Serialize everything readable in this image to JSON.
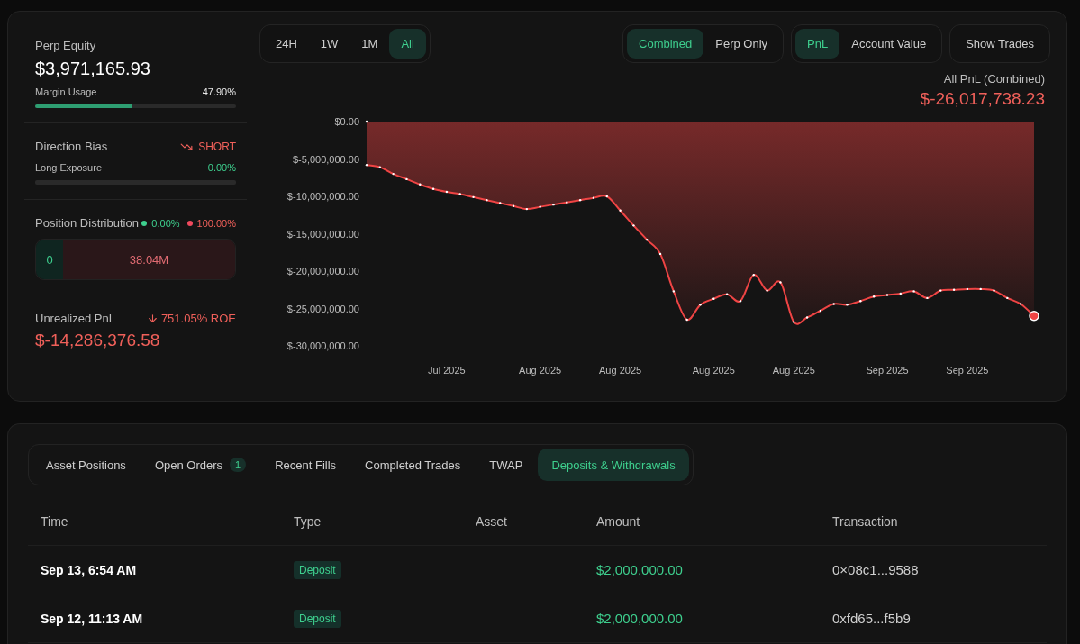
{
  "summary": {
    "equity": {
      "label": "Perp Equity",
      "value": "$3,971,165.93",
      "meter_label": "Margin Usage",
      "meter_reading": "47.90%",
      "level": 0.479
    },
    "bias": {
      "label": "Direction Bias",
      "value": "SHORT",
      "meter_label": "Long Exposure",
      "meter_reading": "0.00%",
      "level": 0
    },
    "distribution": {
      "label": "Position Distribution",
      "long_share": "0.00%",
      "short_share": "100.00%",
      "long_value": "0",
      "short_value": "38.04M"
    },
    "unrealized": {
      "label": "Unrealized PnL",
      "roe": "751.05% ROE",
      "value": "$-14,286,376.58"
    }
  },
  "ranges": [
    {
      "label": "24H",
      "selected": false
    },
    {
      "label": "1W",
      "selected": false
    },
    {
      "label": "1M",
      "selected": false
    },
    {
      "label": "All",
      "selected": true
    }
  ],
  "scopes": [
    {
      "label": "Combined",
      "selected": true
    },
    {
      "label": "Perp Only",
      "selected": false
    }
  ],
  "metrics": [
    {
      "label": "PnL",
      "selected": true
    },
    {
      "label": "Account Value",
      "selected": false
    }
  ],
  "show_trades": "Show Trades",
  "pnl": {
    "label": "All PnL (Combined)",
    "value": "$-26,017,738.23",
    "chart_data": {
      "type": "area",
      "ylim": [
        -30000000,
        0
      ],
      "yticks": [
        {
          "value": 0,
          "label": "$0.00"
        },
        {
          "value": -5000000,
          "label": "$-5,000,000.00"
        },
        {
          "value": -10000000,
          "label": "$-10,000,000.00"
        },
        {
          "value": -15000000,
          "label": "$-15,000,000.00"
        },
        {
          "value": -20000000,
          "label": "$-20,000,000.00"
        },
        {
          "value": -25000000,
          "label": "$-25,000,000.00"
        },
        {
          "value": -30000000,
          "label": "$-30,000,000.00"
        }
      ],
      "categories": [
        null,
        null,
        null,
        null,
        null,
        null,
        "Jul 2025",
        null,
        null,
        null,
        null,
        null,
        null,
        "Aug 2025",
        null,
        null,
        null,
        null,
        null,
        "Aug 2025",
        null,
        null,
        null,
        null,
        null,
        null,
        "Aug 2025",
        null,
        null,
        null,
        null,
        null,
        "Aug 2025",
        null,
        null,
        null,
        null,
        null,
        null,
        "Sep 2025",
        null,
        null,
        null,
        null,
        null,
        "Sep 2025",
        null,
        null,
        null,
        null,
        null
      ],
      "series": [
        {
          "color": "#ef4444",
          "values": [
            -5800000,
            -6100000,
            -7000000,
            -7700000,
            -8400000,
            -9000000,
            -9400000,
            -9700000,
            -10100000,
            -10500000,
            -10900000,
            -11300000,
            -11700000,
            -11400000,
            -11100000,
            -10800000,
            -10500000,
            -10200000,
            -10000000,
            -11900000,
            -13900000,
            -15800000,
            -17700000,
            -22700000,
            -26500000,
            -24500000,
            -23700000,
            -23100000,
            -24000000,
            -20500000,
            -22600000,
            -21500000,
            -26800000,
            -26200000,
            -25300000,
            -24400000,
            -24500000,
            -24000000,
            -23400000,
            -23200000,
            -23000000,
            -22700000,
            -23600000,
            -22600000,
            -22500000,
            -22400000,
            -22400000,
            -22600000,
            -23600000,
            -24400000,
            -26000000
          ]
        }
      ]
    }
  },
  "tabs": [
    {
      "label": "Asset Positions",
      "selected": false
    },
    {
      "label": "Open Orders",
      "count": "1",
      "selected": false
    },
    {
      "label": "Recent Fills",
      "selected": false
    },
    {
      "label": "Completed Trades",
      "selected": false
    },
    {
      "label": "TWAP",
      "selected": false
    },
    {
      "label": "Deposits & Withdrawals",
      "selected": true
    }
  ],
  "table": {
    "columns": [
      "Time",
      "Type",
      "Asset",
      "Amount",
      "Transaction"
    ],
    "rows": [
      {
        "time": "Sep 13, 6:54 AM",
        "type": "Deposit",
        "amount": "$2,000,000.00",
        "transaction": "0×08c1...9588"
      },
      {
        "time": "Sep 12, 11:13 AM",
        "type": "Deposit",
        "amount": "$2,000,000.00",
        "transaction": "0xfd65...f5b9"
      }
    ]
  }
}
